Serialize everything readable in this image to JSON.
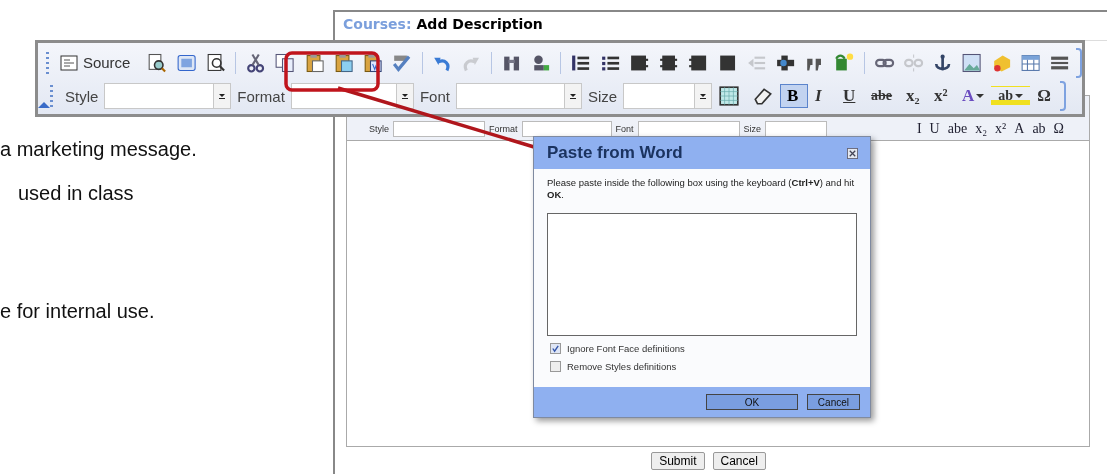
{
  "left_text": [
    "a marketing message.",
    "used in class",
    "e for internal use."
  ],
  "page_title": {
    "section": "Courses:",
    "title": "Add Description"
  },
  "editor_toolbar": {
    "labels": [
      "Style",
      "Format",
      "Font",
      "Size"
    ],
    "glyphs": [
      "I",
      "U",
      "abe",
      "x₂",
      "x²",
      "A",
      "ab",
      "Ω"
    ]
  },
  "toolbar_callout": {
    "source_label": "Source",
    "tools": [
      {
        "disabled": false
      },
      {
        "disabled": false
      },
      {
        "disabled": false
      },
      {
        "disabled": false
      },
      {
        "disabled": false
      },
      {
        "disabled": false
      },
      {
        "disabled": false
      },
      {
        "disabled": false
      },
      {
        "disabled": false
      },
      {
        "disabled": false
      },
      {
        "disabled": true
      },
      {
        "disabled": false
      },
      {
        "disabled": false
      },
      {
        "disabled": false
      },
      {
        "disabled": false
      },
      {
        "disabled": false
      },
      {
        "disabled": false
      },
      {
        "disabled": false
      },
      {
        "disabled": false
      },
      {
        "disabled": true
      },
      {
        "disabled": false
      },
      {
        "disabled": false
      },
      {
        "disabled": false
      },
      {
        "disabled": false
      },
      {
        "disabled": true
      },
      {
        "disabled": false
      },
      {
        "disabled": false
      },
      {
        "disabled": false
      },
      {
        "disabled": false
      },
      {
        "disabled": false
      }
    ],
    "combos": [
      "Style",
      "Format",
      "Font",
      "Size"
    ],
    "format_buttons": [
      {
        "label": "B",
        "kind": "button",
        "selected": true
      },
      {
        "label": "I",
        "kind": "button",
        "selected": false
      },
      {
        "label": "U",
        "kind": "button",
        "selected": false
      },
      {
        "label": "abe",
        "kind": "button",
        "selected": false
      },
      {
        "label": "x₂",
        "kind": "button",
        "selected": false
      },
      {
        "label": "x²",
        "kind": "button",
        "selected": false
      },
      {
        "label": "A",
        "kind": "menu",
        "selected": false
      },
      {
        "label": "ab",
        "kind": "menu",
        "selected": false
      },
      {
        "label": "Ω",
        "kind": "button",
        "selected": false
      }
    ]
  },
  "dialog": {
    "title": "Paste from Word",
    "message": "Please paste inside the following box using the keyboard (**Ctrl+V**) and hit **OK**.",
    "options": [
      {
        "label": "Ignore Font Face definitions",
        "checked": true
      },
      {
        "label": "Remove Styles definitions",
        "checked": false
      }
    ],
    "buttons": [
      "OK",
      "Cancel"
    ]
  },
  "form_buttons": [
    "Submit",
    "Cancel"
  ]
}
